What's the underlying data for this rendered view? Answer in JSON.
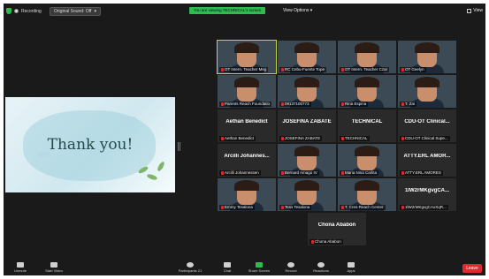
{
  "topbar": {
    "recording_label": "Recording",
    "original_sound_label": "Original Sound: Off",
    "viewing_banner": "You are viewing TECHNICAL's screen",
    "view_options_label": "View Options",
    "view_label": "View"
  },
  "slide": {
    "text": "Thank you!"
  },
  "tiles": [
    {
      "name": "",
      "label": "OT Intern. Teacher Meg"
    },
    {
      "name": "",
      "label": "RC Cebu-Fuente Tope"
    },
    {
      "name": "",
      "label": "OT Intern. Teacher Czar"
    },
    {
      "name": "",
      "label": "OT Geelyn"
    },
    {
      "name": "",
      "label": "Parents Reach Foundatio"
    },
    {
      "name": "",
      "label": "09137100773"
    },
    {
      "name": "",
      "label": "Rina Espina"
    },
    {
      "name": "",
      "label": "T. Zai"
    },
    {
      "name": "Aethan Benedict",
      "label": "Aethan Benedict"
    },
    {
      "name": "JOSEFINA ZABATE",
      "label": "JOSEFINA ZABATE"
    },
    {
      "name": "TECHNICAL",
      "label": "TECHNICAL"
    },
    {
      "name": "CDU-OT Clinical...",
      "label": "CDU-OT Clinical Supe..."
    },
    {
      "name": "Arcilli Johannes...",
      "label": "Arcilli Johannessen"
    },
    {
      "name": "",
      "label": "Bernard Amago IV"
    },
    {
      "name": "",
      "label": "Maria Nina Carlita"
    },
    {
      "name": "ATTY.ERL AMOR...",
      "label": "ATTY.ERL AMORES"
    },
    {
      "name": "",
      "label": "Emmy Tesalona"
    },
    {
      "name": "",
      "label": "Tess Tesalona"
    },
    {
      "name": "",
      "label": "T. Cres-Reach Center"
    },
    {
      "name": "1lW2rMKgvgCA...",
      "label": "1lW2rMKgvgCAxXqR..."
    },
    {
      "name": "Chona Ababon",
      "label": "Chona Ababon"
    }
  ],
  "toolbar": {
    "unmute": "Unmute",
    "start_video": "Start Video",
    "participants": "Participants",
    "participants_count": "21",
    "chat": "Chat",
    "share_screen": "Share Screen",
    "record": "Record",
    "reactions": "Reactions",
    "apps": "Apps",
    "leave": "Leave"
  }
}
